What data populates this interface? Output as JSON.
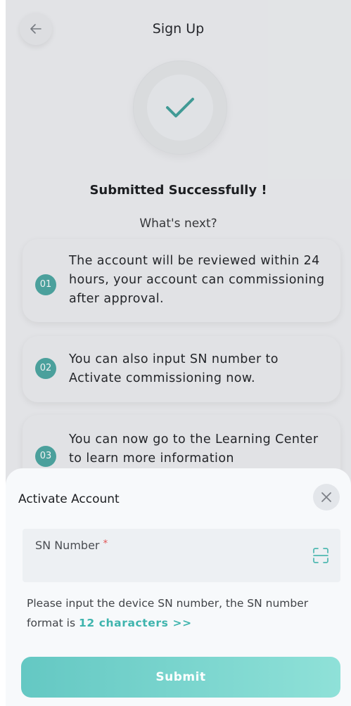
{
  "header": {
    "title": "Sign Up",
    "back_icon": "arrow-left-icon"
  },
  "status": {
    "icon": "check-icon",
    "title": "Submitted Successfully !",
    "subtitle": "What's next?"
  },
  "steps": [
    {
      "number": "01",
      "text": "The account will be reviewed within 24 hours, your account can commissioning after approval."
    },
    {
      "number": "02",
      "text": "You can also input SN number to Activate commissioning now."
    },
    {
      "number": "03",
      "text": "You can now go to the Learning Center to learn more information"
    }
  ],
  "sheet": {
    "title": "Activate Account",
    "close_icon": "close-icon",
    "sn_field": {
      "label": "SN Number",
      "required_mark": "*",
      "value": "",
      "scan_icon": "scan-icon"
    },
    "hint_text": "Please input the device SN number,  the SN number format is ",
    "hint_link": "12 characters >>",
    "submit_label": "Submit"
  },
  "colors": {
    "accent": "#3eb4ad",
    "badge": "#4aa7a1",
    "required": "#e15252",
    "submit_start": "#64c8c3",
    "submit_end": "#8fe1d8"
  }
}
